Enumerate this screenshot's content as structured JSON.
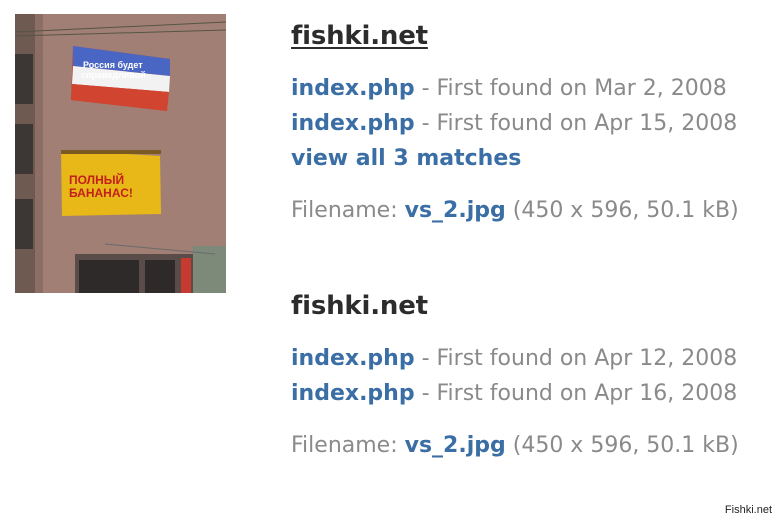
{
  "results": [
    {
      "site": "fishki.net",
      "matches": [
        {
          "page": "index.php",
          "found_text": " - First found on Mar 2, 2008"
        },
        {
          "page": "index.php",
          "found_text": " - First found on Apr 15, 2008"
        }
      ],
      "view_all": "view all 3 matches",
      "filename_label": "Filename: ",
      "filename": "vs_2.jpg",
      "file_info": " (450 x 596, 50.1 kB)"
    },
    {
      "site": "fishki.net",
      "matches": [
        {
          "page": "index.php",
          "found_text": " - First found on Apr 12, 2008"
        },
        {
          "page": "index.php",
          "found_text": " - First found on Apr 16, 2008"
        }
      ],
      "filename_label": "Filename: ",
      "filename": "vs_2.jpg",
      "file_info": " (450 x 596, 50.1 kB)"
    }
  ],
  "thumbnail": {
    "billboard_top_text_1": "Россия будет",
    "billboard_top_text_2": "справедливой",
    "billboard_bottom_text_1": "ПОЛНЫЙ",
    "billboard_bottom_text_2": "БАНАНАС!"
  },
  "watermark": "Fishki.net"
}
